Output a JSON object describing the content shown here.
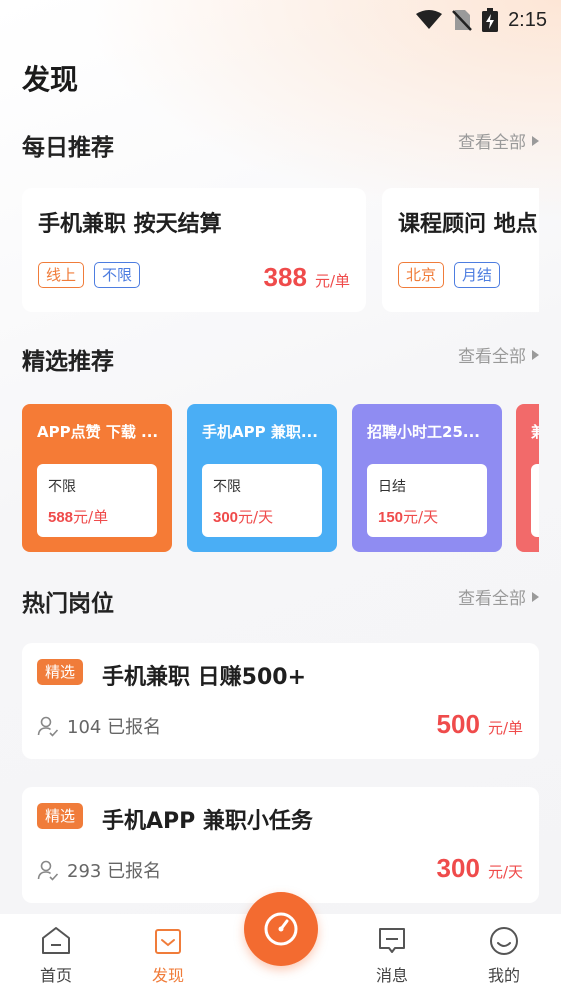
{
  "status_bar": {
    "time": "2:15"
  },
  "page_title": "发现",
  "daily": {
    "title": "每日推荐",
    "view_all": "查看全部",
    "cards": [
      {
        "title": "手机兼职   按天结算",
        "tags": [
          "线上",
          "不限"
        ],
        "price": "388",
        "unit": "元/单"
      },
      {
        "title": "课程顾问 地点",
        "tags": [
          "北京",
          "月结"
        ]
      }
    ]
  },
  "picks": {
    "title": "精选推荐",
    "view_all": "查看全部",
    "cards": [
      {
        "title": "APP点赞 下载 ...",
        "label": "不限",
        "price": "588",
        "unit": "元/单",
        "color": "#f57b36"
      },
      {
        "title": "手机APP  兼职...",
        "label": "不限",
        "price": "300",
        "unit": "元/天",
        "color": "#4aaef5"
      },
      {
        "title": "招聘小时工25...",
        "label": "日结",
        "price": "150",
        "unit": "元/天",
        "color": "#8f8cf2"
      },
      {
        "title": "兼",
        "color": "#f26a6a"
      }
    ]
  },
  "hot": {
    "title": "热门岗位",
    "view_all": "查看全部",
    "items": [
      {
        "badge": "精选",
        "title": "手机兼职 日赚500+",
        "signups": "104 已报名",
        "price": "500",
        "unit": "元/单"
      },
      {
        "badge": "精选",
        "title": "手机APP  兼职小任务",
        "signups": "293 已报名",
        "price": "300",
        "unit": "元/天"
      }
    ]
  },
  "tabbar": {
    "items": [
      {
        "label": "首页",
        "icon": "home-icon"
      },
      {
        "label": "发现",
        "icon": "discover-icon",
        "active": true
      },
      {
        "label": "消息",
        "icon": "message-icon"
      },
      {
        "label": "我的",
        "icon": "profile-icon"
      }
    ],
    "center_icon": "timer-icon"
  },
  "colors": {
    "accent": "#f07c3a",
    "price": "#ef4b4b",
    "tag_blue": "#4d7de0"
  }
}
